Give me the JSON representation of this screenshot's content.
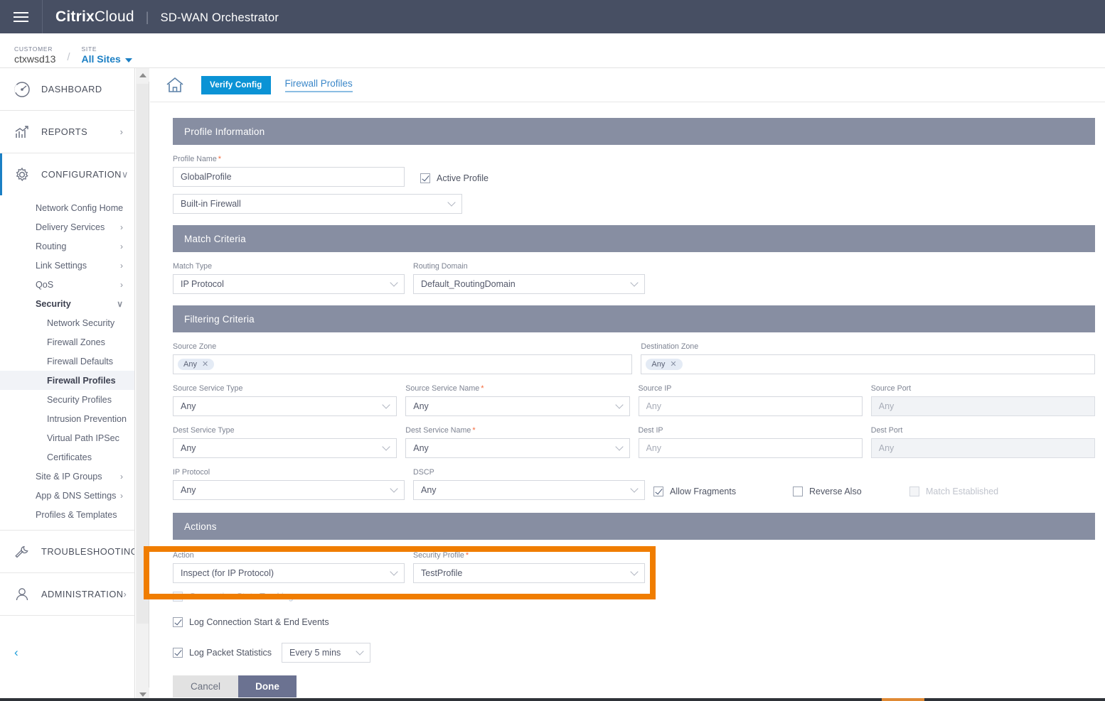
{
  "navbar": {
    "menu_icon": "hamburger-icon",
    "brand_bold": "Citrix",
    "brand_light": "Cloud",
    "separator": "|",
    "app_title": "SD-WAN Orchestrator"
  },
  "subbar": {
    "customer_label": "CUSTOMER",
    "customer_value": "ctxwsd13",
    "slash": "/",
    "site_label": "SITE",
    "site_value": "All Sites"
  },
  "sidebar": {
    "sections": [
      {
        "label": "DASHBOARD",
        "icon": "dashboard-gauge-icon",
        "arrow": ""
      },
      {
        "label": "REPORTS",
        "icon": "reports-chart-icon",
        "arrow": "›"
      },
      {
        "label": "CONFIGURATION",
        "icon": "configuration-gear-icon",
        "arrow": "∨"
      },
      {
        "label": "TROUBLESHOOTING",
        "icon": "troubleshooting-wrench-icon",
        "arrow": "›"
      },
      {
        "label": "ADMINISTRATION",
        "icon": "administration-user-icon",
        "arrow": "›"
      }
    ],
    "configuration_items": [
      {
        "label": "Network Config Home",
        "arrow": "",
        "child": false,
        "selected": false,
        "bold": false
      },
      {
        "label": "Delivery Services",
        "arrow": "›",
        "child": false,
        "selected": false,
        "bold": false
      },
      {
        "label": "Routing",
        "arrow": "›",
        "child": false,
        "selected": false,
        "bold": false
      },
      {
        "label": "Link Settings",
        "arrow": "›",
        "child": false,
        "selected": false,
        "bold": false
      },
      {
        "label": "QoS",
        "arrow": "›",
        "child": false,
        "selected": false,
        "bold": false
      },
      {
        "label": "Security",
        "arrow": "∨",
        "child": false,
        "selected": false,
        "bold": true
      },
      {
        "label": "Network Security",
        "arrow": "",
        "child": true,
        "selected": false,
        "bold": false
      },
      {
        "label": "Firewall Zones",
        "arrow": "",
        "child": true,
        "selected": false,
        "bold": false
      },
      {
        "label": "Firewall Defaults",
        "arrow": "",
        "child": true,
        "selected": false,
        "bold": false
      },
      {
        "label": "Firewall Profiles",
        "arrow": "",
        "child": true,
        "selected": true,
        "bold": false
      },
      {
        "label": "Security Profiles",
        "arrow": "",
        "child": true,
        "selected": false,
        "bold": false
      },
      {
        "label": "Intrusion Prevention",
        "arrow": "",
        "child": true,
        "selected": false,
        "bold": false
      },
      {
        "label": "Virtual Path IPSec",
        "arrow": "",
        "child": true,
        "selected": false,
        "bold": false
      },
      {
        "label": "Certificates",
        "arrow": "",
        "child": true,
        "selected": false,
        "bold": false
      },
      {
        "label": "Site & IP Groups",
        "arrow": "›",
        "child": false,
        "selected": false,
        "bold": false
      },
      {
        "label": "App & DNS Settings",
        "arrow": "›",
        "child": false,
        "selected": false,
        "bold": false
      },
      {
        "label": "Profiles & Templates",
        "arrow": "",
        "child": false,
        "selected": false,
        "bold": false
      }
    ],
    "collapse_icon": "‹"
  },
  "toolbar": {
    "home_icon": "home-icon",
    "verify_config_label": "Verify Config",
    "tab_label": "Firewall Profiles"
  },
  "sections": {
    "profile_information": "Profile Information",
    "match_criteria": "Match Criteria",
    "filtering_criteria": "Filtering Criteria",
    "actions": "Actions"
  },
  "profile_information": {
    "profile_name_label": "Profile Name",
    "profile_name_value": "GlobalProfile",
    "active_profile_label": "Active Profile",
    "active_profile_checked": true,
    "firewall_type_value": "Built-in Firewall"
  },
  "match_criteria": {
    "match_type_label": "Match Type",
    "match_type_value": "IP Protocol",
    "routing_domain_label": "Routing Domain",
    "routing_domain_value": "Default_RoutingDomain"
  },
  "filtering_criteria": {
    "source_zone_label": "Source Zone",
    "source_zone_token": "Any",
    "destination_zone_label": "Destination Zone",
    "destination_zone_token": "Any",
    "source_service_type_label": "Source Service Type",
    "source_service_type_value": "Any",
    "source_service_name_label": "Source Service Name",
    "source_service_name_value": "Any",
    "source_ip_label": "Source IP",
    "source_ip_placeholder": "Any",
    "source_port_label": "Source Port",
    "source_port_placeholder": "Any",
    "dest_service_type_label": "Dest Service Type",
    "dest_service_type_value": "Any",
    "dest_service_name_label": "Dest Service Name",
    "dest_service_name_value": "Any",
    "dest_ip_label": "Dest IP",
    "dest_ip_placeholder": "Any",
    "dest_port_label": "Dest Port",
    "dest_port_placeholder": "Any",
    "ip_protocol_label": "IP Protocol",
    "ip_protocol_value": "Any",
    "dscp_label": "DSCP",
    "dscp_value": "Any",
    "allow_fragments_label": "Allow Fragments",
    "allow_fragments_checked": true,
    "reverse_also_label": "Reverse Also",
    "reverse_also_checked": false,
    "match_established_label": "Match Established",
    "match_established_checked": false
  },
  "actions": {
    "action_label": "Action",
    "action_value": "Inspect (for IP Protocol)",
    "security_profile_label": "Security Profile",
    "security_profile_value": "TestProfile",
    "connection_state_tracking_label": "Connection State Tracking",
    "connection_state_tracking_checked": false,
    "log_connection_events_label": "Log Connection Start & End Events",
    "log_connection_events_checked": true,
    "log_packet_statistics_label": "Log Packet Statistics",
    "log_packet_statistics_checked": true,
    "log_interval_value": "Every 5 mins",
    "cancel_label": "Cancel",
    "done_label": "Done"
  },
  "colors": {
    "navbar": "#474f63",
    "section_header": "#878ea2",
    "accent_blue": "#0b93d5",
    "link_blue": "#1b7fc4",
    "highlight_orange": "#f07d00",
    "required_red": "#f5693b",
    "done_button": "#6b7291"
  }
}
